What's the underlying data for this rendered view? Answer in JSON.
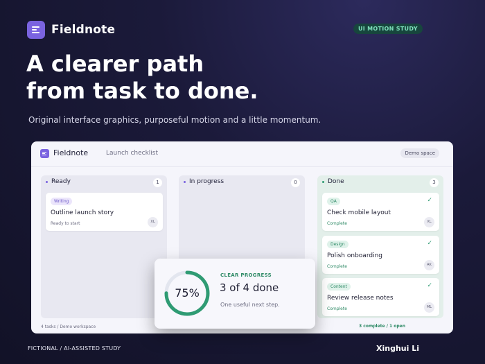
{
  "brand": {
    "name": "Fieldnote",
    "icon": "menu-lines-icon"
  },
  "badge": "UI MOTION STUDY",
  "hero": {
    "headline_line1": "A clearer path",
    "headline_line2": "from task to done.",
    "subline": "Original interface graphics, purposeful motion and a little momentum."
  },
  "app": {
    "name": "Fieldnote",
    "section": "Launch checklist",
    "space": "Demo space",
    "columns": [
      {
        "title": "Ready",
        "count": "1",
        "cards": [
          {
            "tag": "Writing",
            "title": "Outline launch story",
            "status": "Ready to start",
            "avatar": "XL"
          }
        ]
      },
      {
        "title": "In progress",
        "count": "0",
        "cards": []
      },
      {
        "title": "Done",
        "count": "3",
        "cards": [
          {
            "tag": "QA",
            "title": "Check mobile layout",
            "status": "Complete",
            "avatar": "XL"
          },
          {
            "tag": "Design",
            "title": "Polish onboarding",
            "status": "Complete",
            "avatar": "AK"
          },
          {
            "tag": "Content",
            "title": "Review release notes",
            "status": "Complete",
            "avatar": "ML"
          }
        ]
      }
    ],
    "footer_left": "4 tasks  /  Demo workspace",
    "footer_right": "3 complete  /  1 open"
  },
  "progress": {
    "percent_label": "75%",
    "percent": 0.75,
    "kicker": "CLEAR PROGRESS",
    "title": "3 of 4 done",
    "sub": "One useful next step."
  },
  "footer": {
    "left": "FICTIONAL  /  AI-ASSISTED STUDY",
    "right": "Xinghui Li"
  },
  "colors": {
    "accent": "#7a63e0",
    "success": "#2f9b73",
    "background": "#1b1a3a"
  }
}
